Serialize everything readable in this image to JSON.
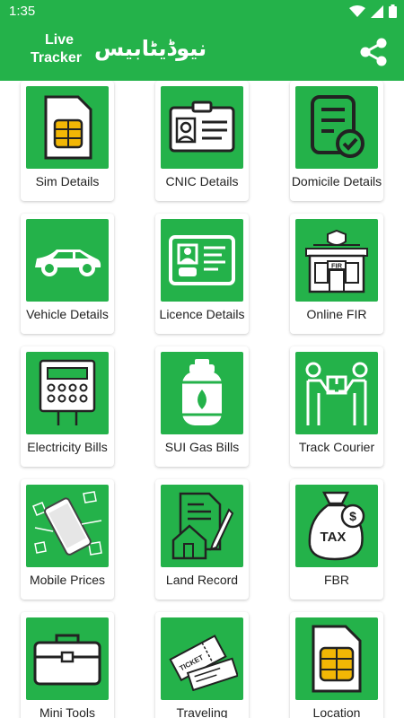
{
  "status_bar": {
    "time": "1:35"
  },
  "app_bar": {
    "title_line1": "Live",
    "title_line2": "Tracker",
    "urdu_title": "نیوڈیٹابیس"
  },
  "colors": {
    "brand_green": "#24b24a",
    "tile_green": "#24b24a"
  },
  "tiles": [
    {
      "label": "Sim Details",
      "icon": "sim-card-icon"
    },
    {
      "label": "CNIC Details",
      "icon": "id-card-icon"
    },
    {
      "label": "Domicile Details",
      "icon": "document-check-icon"
    },
    {
      "label": "Vehicle Details",
      "icon": "car-icon"
    },
    {
      "label": "Licence Details",
      "icon": "licence-icon"
    },
    {
      "label": "Online FIR",
      "icon": "police-station-icon"
    },
    {
      "label": "Electricity Bills",
      "icon": "electric-meter-icon"
    },
    {
      "label": "SUI Gas Bills",
      "icon": "gas-cylinder-icon"
    },
    {
      "label": "Track Courier",
      "icon": "courier-handover-icon"
    },
    {
      "label": "Mobile Prices",
      "icon": "mobile-phone-icon"
    },
    {
      "label": "Land Record",
      "icon": "land-record-icon"
    },
    {
      "label": "FBR",
      "icon": "tax-bag-icon"
    },
    {
      "label": "Mini Tools",
      "icon": "toolbox-icon"
    },
    {
      "label": "Traveling",
      "icon": "tickets-icon"
    },
    {
      "label": "Location",
      "icon": "sim-chip-icon"
    }
  ],
  "fir_sign": "FIR",
  "tax_text": "TAX",
  "ticket_text": "TICKET"
}
